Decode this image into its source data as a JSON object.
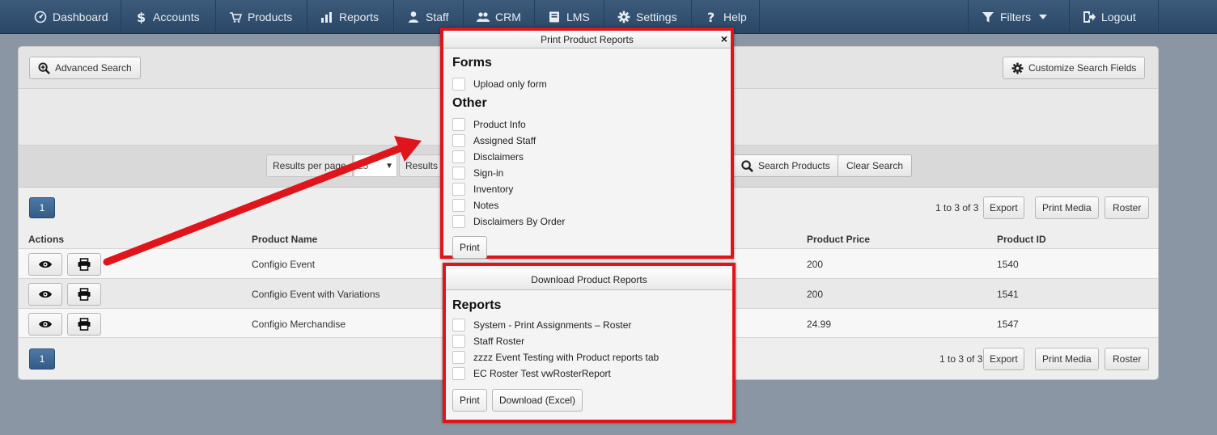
{
  "nav": {
    "left": [
      {
        "label": "Dashboard",
        "icon": "dashboard-icon"
      },
      {
        "label": "Accounts",
        "icon": "dollar-icon"
      },
      {
        "label": "Products",
        "icon": "cart-icon"
      },
      {
        "label": "Reports",
        "icon": "bar-chart-icon"
      },
      {
        "label": "Staff",
        "icon": "person-icon"
      },
      {
        "label": "CRM",
        "icon": "users-icon"
      },
      {
        "label": "LMS",
        "icon": "book-icon"
      },
      {
        "label": "Settings",
        "icon": "gear-icon"
      },
      {
        "label": "Help",
        "icon": "question-icon"
      }
    ],
    "filters": "Filters",
    "logout": "Logout"
  },
  "toolbar": {
    "advanced_search": "Advanced Search",
    "customize_search_fields": "Customize Search Fields",
    "results_per_page_label": "Results per page",
    "results_per_page_value": "25",
    "results_label": "Results",
    "search_products": "Search Products",
    "clear_search": "Clear Search"
  },
  "pager": {
    "page": "1",
    "range_top": "1 to 3 of 3",
    "range_bottom": "1 to 3 of 3",
    "export": "Export",
    "print_media": "Print Media",
    "roster": "Roster"
  },
  "table": {
    "headers": {
      "actions": "Actions",
      "name": "Product Name",
      "price": "Product Price",
      "id": "Product ID"
    },
    "rows": [
      {
        "name": "Configio Event",
        "price": "200",
        "id": "1540"
      },
      {
        "name": "Configio Event with Variations",
        "price": "200",
        "id": "1541"
      },
      {
        "name": "Configio Merchandise",
        "price": "24.99",
        "id": "1547"
      }
    ]
  },
  "print_dialog": {
    "title": "Print Product Reports",
    "close": "×",
    "forms_heading": "Forms",
    "forms": [
      "Upload only form"
    ],
    "other_heading": "Other",
    "other": [
      "Product Info",
      "Assigned Staff",
      "Disclaimers",
      "Sign-in",
      "Inventory",
      "Notes",
      "Disclaimers By Order"
    ],
    "print_button": "Print"
  },
  "download_dialog": {
    "title": "Download Product Reports",
    "reports_heading": "Reports",
    "reports": [
      "System - Print Assignments – Roster",
      "Staff Roster",
      "zzzz Event Testing with Product reports tab",
      "EC Roster Test vwRosterReport"
    ],
    "print_button": "Print",
    "download_button": "Download (Excel)"
  },
  "colors": {
    "highlight": "#e0151c",
    "nav": "#2f4d6e",
    "primary": "#3d6896"
  }
}
